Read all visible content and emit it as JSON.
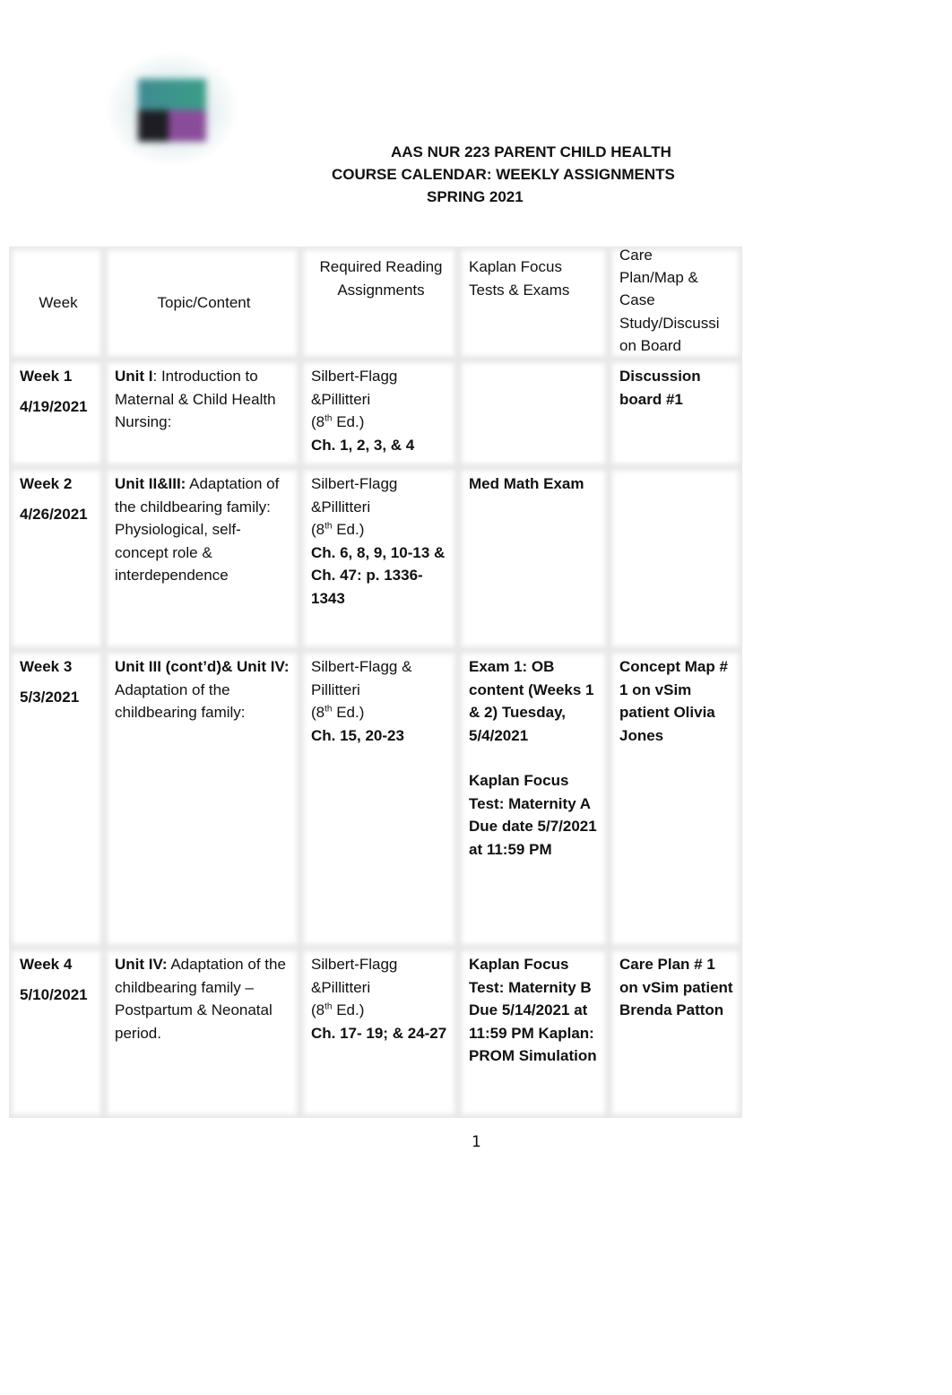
{
  "header": {
    "logo_icon": "college-seal-logo",
    "title_line1": "AAS NUR 223 PARENT CHILD HEALTH",
    "title_line2": "COURSE CALENDAR: WEEKLY ASSIGNMENTS",
    "title_line3": "SPRING 2021"
  },
  "table": {
    "columns": [
      "Week",
      "Topic/Content",
      "Required Reading Assignments",
      "Kaplan Focus Tests & Exams",
      "Care Plan/Map & Case Study/Discussion Board"
    ],
    "columns_display": {
      "c3_l1": "Required Reading",
      "c3_l2": "Assignments",
      "c4_l1": "Kaplan Focus",
      "c4_l2": "Tests & Exams",
      "c5_l1": "Care",
      "c5_l2": "Plan/Map &",
      "c5_l3": "Case",
      "c5_l4": "Study/Discussi",
      "c5_l5": "on Board"
    },
    "rows": [
      {
        "week": "Week 1",
        "date": "4/19/2021",
        "topic_bold": "Unit I",
        "topic_rest": ": Introduction to Maternal & Child Health Nursing:",
        "reading_author": "Silbert-Flagg &Pillitteri",
        "reading_edition_pre": "(8",
        "reading_edition_sup": "th",
        "reading_edition_post": " Ed.)",
        "reading_chapters": "Ch. 1, 2, 3, & 4",
        "kaplan": "",
        "careplan": "Discussion board #1"
      },
      {
        "week": "Week 2",
        "date": "4/26/2021",
        "topic_bold": "Unit II&III:",
        "topic_rest": " Adaptation of the childbearing family: Physiological, self-concept role & interdependence",
        "reading_author": "Silbert-Flagg &Pillitteri",
        "reading_edition_pre": "(8",
        "reading_edition_sup": "th",
        "reading_edition_post": " Ed.)",
        "reading_chapters": "Ch. 6, 8, 9, 10-13 & Ch. 47: p. 1336-1343",
        "kaplan": "Med Math Exam",
        "careplan": ""
      },
      {
        "week": "Week 3",
        "date": "5/3/2021",
        "topic_bold": "Unit III (cont’d)& Unit IV:",
        "topic_rest": " Adaptation of the childbearing family:",
        "reading_author": "Silbert-Flagg & Pillitteri",
        "reading_edition_pre": "(8",
        "reading_edition_sup": "th",
        "reading_edition_post": " Ed.)",
        "reading_chapters": "Ch. 15, 20-23",
        "kaplan": "Exam 1: OB content (Weeks 1 & 2) Tuesday, 5/4/2021",
        "kaplan_2": "Kaplan Focus Test: Maternity A Due date 5/7/2021 at 11:59 PM",
        "careplan": "Concept Map # 1 on vSim patient Olivia Jones"
      },
      {
        "week": "Week 4",
        "date": "5/10/2021",
        "topic_bold": "Unit IV:",
        "topic_rest": " Adaptation of the childbearing family –Postpartum & Neonatal period.",
        "reading_author": "Silbert-Flagg &Pillitteri",
        "reading_edition_pre": "(8",
        "reading_edition_sup": "th",
        "reading_edition_post": " Ed.)",
        "reading_chapters": "Ch. 17- 19; & 24-27",
        "kaplan": "Kaplan Focus Test: Maternity B Due 5/14/2021 at 11:59 PM Kaplan: PROM Simulation",
        "careplan": "Care Plan # 1 on vSim patient Brenda Patton"
      }
    ]
  },
  "footer": {
    "page_number": "1"
  }
}
